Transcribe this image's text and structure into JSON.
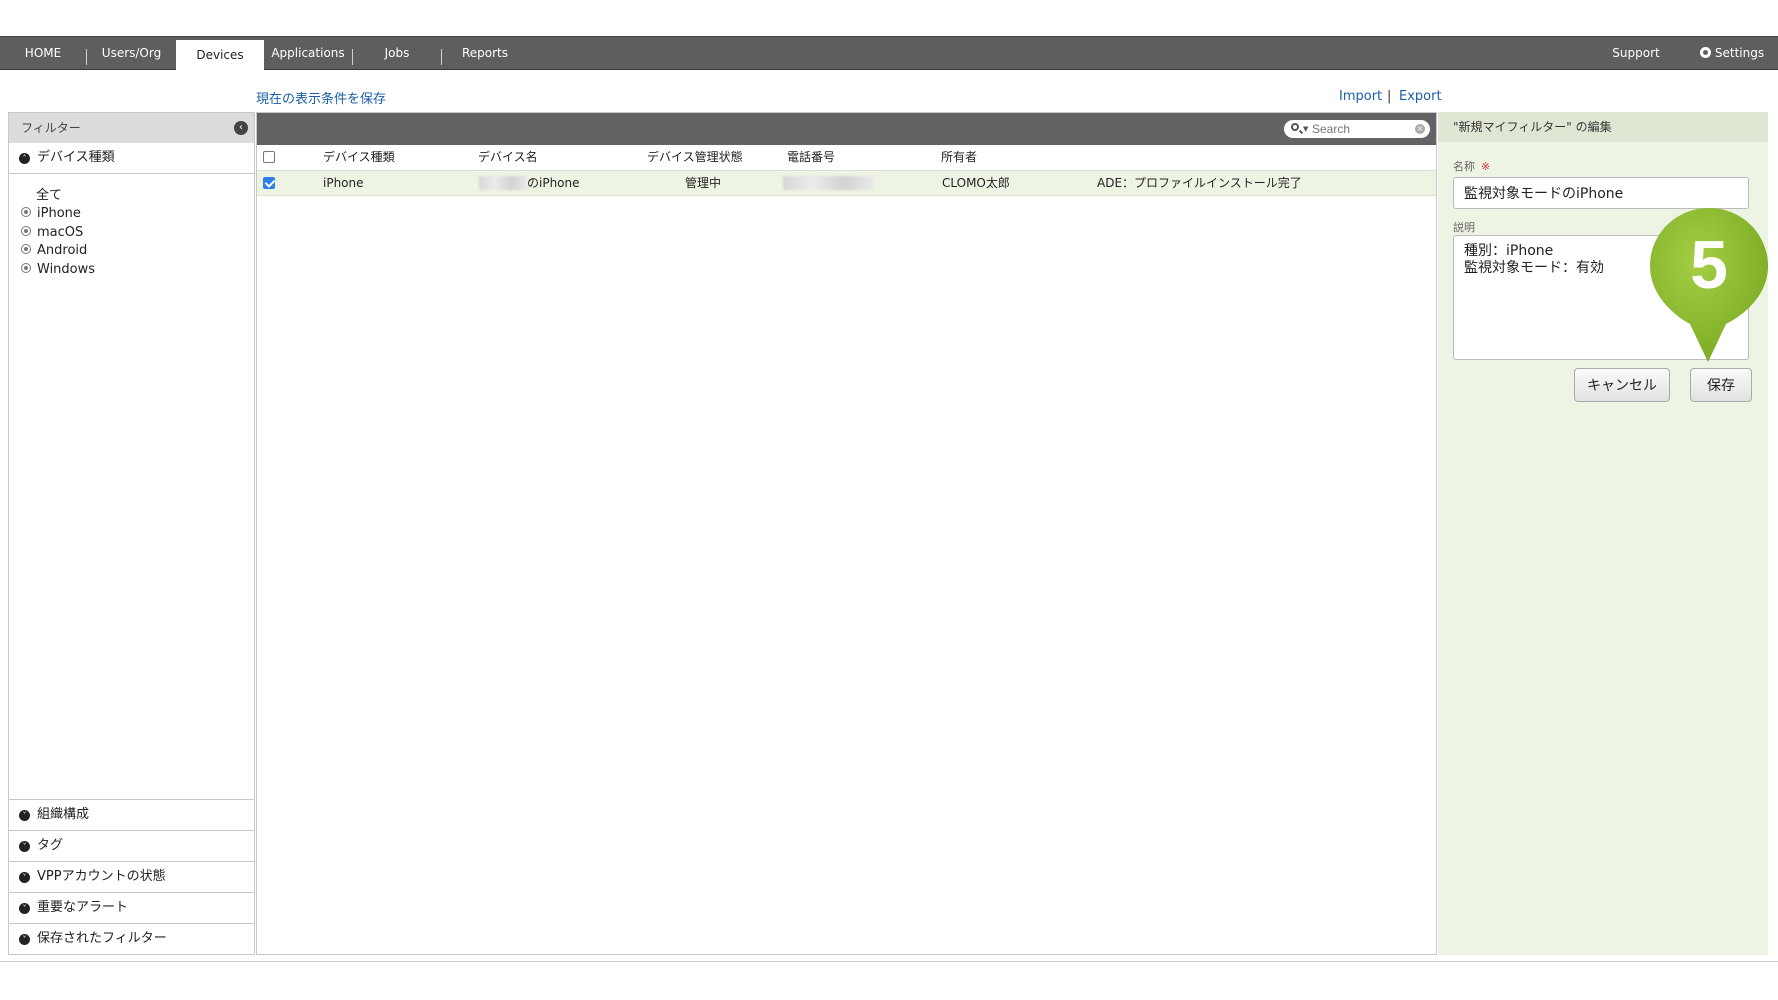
{
  "nav": {
    "tabs": [
      {
        "label": "HOME"
      },
      {
        "label": "Users/Org"
      },
      {
        "label": "Devices"
      },
      {
        "label": "Applications"
      },
      {
        "label": "Jobs"
      },
      {
        "label": "Reports"
      }
    ],
    "active_tab": "Devices",
    "support": "Support",
    "settings": "Settings"
  },
  "links": {
    "save_view": "現在の表示条件を保存",
    "import": "Import",
    "export": "Export",
    "divider": "|"
  },
  "sidebar": {
    "title": "フィルター",
    "device_type_section": "デバイス種類",
    "device_types": [
      "全て",
      "iPhone",
      "macOS",
      "Android",
      "Windows"
    ],
    "bottom_sections": [
      "組織構成",
      "タグ",
      "VPPアカウントの状態",
      "重要なアラート",
      "保存されたフィルター"
    ]
  },
  "table": {
    "search_placeholder": "Search",
    "columns": [
      "デバイス種類",
      "デバイス名",
      "デバイス管理状態",
      "電話番号",
      "所有者"
    ],
    "rows": [
      {
        "checked": true,
        "device_type": "iPhone",
        "device_name_suffix": "のiPhone",
        "management_status": "管理中",
        "owner": "CLOMO太郎",
        "extra": "ADE：プロファイルインストール完了"
      }
    ]
  },
  "editor": {
    "title": "\"新規マイフィルター\" の編集",
    "name_label": "名称",
    "required_mark": "※",
    "name_value": "監視対象モードのiPhone",
    "desc_label": "説明",
    "desc_value": "種別：iPhone\n監視対象モード：有効",
    "cancel": "キャンセル",
    "save": "保存"
  },
  "callout": {
    "number": "5",
    "color": "#86b52a"
  }
}
